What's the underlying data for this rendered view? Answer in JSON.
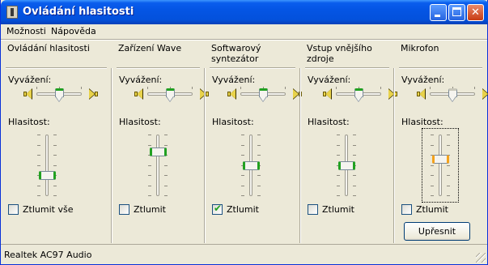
{
  "window": {
    "title": "Ovládání hlasitosti"
  },
  "menu": {
    "items": [
      "Možnosti",
      "Nápověda"
    ]
  },
  "columns": [
    {
      "title": "Ovládání hlasitosti",
      "balance_label": "Vyvážení:",
      "volume_label": "Hlasitost:",
      "mute_label": "Ztlumit vše",
      "muted": false,
      "balance": 0.5,
      "volume": 0.31,
      "enabled": true
    },
    {
      "title": "Zařízení Wave",
      "balance_label": "Vyvážení:",
      "volume_label": "Hlasitost:",
      "mute_label": "Ztlumit",
      "muted": false,
      "balance": 0.5,
      "volume": 0.75,
      "enabled": true
    },
    {
      "title": "Softwarový syntezátor",
      "balance_label": "Vyvážení:",
      "volume_label": "Hlasitost:",
      "mute_label": "Ztlumit",
      "muted": true,
      "balance": 0.5,
      "volume": 0.5,
      "enabled": true
    },
    {
      "title": "Vstup vnějšího zdroje",
      "balance_label": "Vyvážení:",
      "volume_label": "Hlasitost:",
      "mute_label": "Ztlumit",
      "muted": false,
      "balance": 0.5,
      "volume": 0.5,
      "enabled": true
    },
    {
      "title": "Mikrofon",
      "balance_label": "Vyvážení:",
      "volume_label": "Hlasitost:",
      "mute_label": "Ztlumit",
      "muted": false,
      "balance": 0.5,
      "volume": 0.62,
      "enabled": false,
      "advanced_button": "Upřesnit"
    }
  ],
  "status": {
    "text": "Realtek AC97 Audio"
  },
  "colors": {
    "title_bar": "#0455e4",
    "thumb_accent": "#21a121",
    "focused_thumb_accent": "#f4a21c",
    "face": "#ece9d8"
  }
}
